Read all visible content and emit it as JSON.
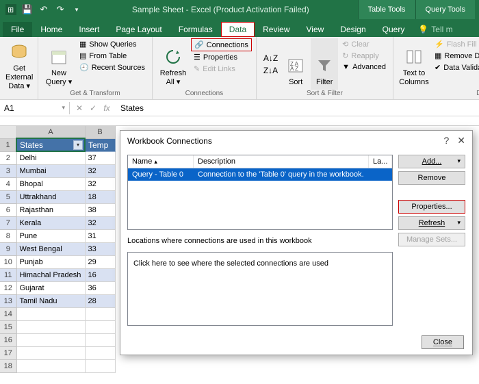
{
  "titlebar": {
    "app_title": "Sample Sheet - Excel (Product Activation Failed)",
    "table_tools": "Table Tools",
    "query_tools": "Query Tools"
  },
  "tabs": {
    "file": "File",
    "home": "Home",
    "insert": "Insert",
    "page_layout": "Page Layout",
    "formulas": "Formulas",
    "data": "Data",
    "review": "Review",
    "view": "View",
    "design": "Design",
    "query": "Query",
    "tellme": "Tell m"
  },
  "ribbon": {
    "get_external_data": "Get External\nData ▾",
    "new_query": "New\nQuery ▾",
    "show_queries": "Show Queries",
    "from_table": "From Table",
    "recent_sources": "Recent Sources",
    "get_transform": "Get & Transform",
    "refresh_all": "Refresh\nAll ▾",
    "connections": "Connections",
    "properties": "Properties",
    "edit_links": "Edit Links",
    "connections_grp": "Connections",
    "sort": "Sort",
    "filter": "Filter",
    "clear": "Clear",
    "reapply": "Reapply",
    "advanced": "Advanced",
    "sort_filter": "Sort & Filter",
    "text_to_cols": "Text to\nColumns",
    "flash_fill": "Flash Fill",
    "remove_dupes": "Remove Dupl",
    "data_validation": "Data Validation",
    "data_tools": "Data T"
  },
  "namebox": "A1",
  "formula": "States",
  "headers": {
    "colA": "A",
    "colB": "B"
  },
  "table": {
    "h1": "States",
    "h2": "Temp",
    "rows": [
      {
        "s": "Delhi",
        "t": "37"
      },
      {
        "s": "Mumbai",
        "t": "32"
      },
      {
        "s": "Bhopal",
        "t": "32"
      },
      {
        "s": "Uttrakhand",
        "t": "18"
      },
      {
        "s": "Rajasthan",
        "t": "38"
      },
      {
        "s": "Kerala",
        "t": "32"
      },
      {
        "s": "Pune",
        "t": "31"
      },
      {
        "s": "West Bengal",
        "t": "33"
      },
      {
        "s": "Punjab",
        "t": "29"
      },
      {
        "s": "Himachal Pradesh",
        "t": "16"
      },
      {
        "s": "Gujarat",
        "t": "36"
      },
      {
        "s": "Tamil Nadu",
        "t": "28"
      }
    ]
  },
  "dialog": {
    "title": "Workbook Connections",
    "col_name": "Name",
    "col_desc": "Description",
    "col_la": "La...",
    "row_name": "Query - Table 0",
    "row_desc": "Connection to the 'Table 0' query in the workbook.",
    "btn_add": "Add...",
    "btn_remove": "Remove",
    "btn_props": "Properties...",
    "btn_refresh": "Refresh",
    "btn_manage": "Manage Sets...",
    "loc_label": "Locations where connections are used in this workbook",
    "loc_hint": "Click here to see where the selected connections are used",
    "close": "Close"
  }
}
